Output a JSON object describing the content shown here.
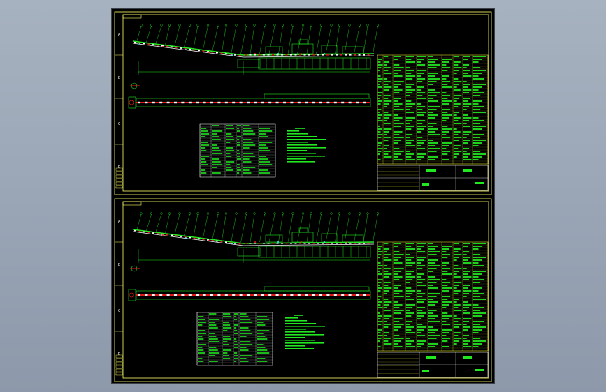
{
  "window": {
    "background": "#9aa6b6",
    "canvas_bg": "#000000"
  },
  "colors": {
    "frame": "#ffff66",
    "line_green": "#22e822",
    "line_red": "#e01818",
    "line_white": "#ffffff",
    "line_cyan": "#3df0ff",
    "table_line": "#ffff33"
  },
  "sheets": [
    {
      "id": "top",
      "zone_labels": [
        "A",
        "B",
        "C",
        "D"
      ]
    },
    {
      "id": "bottom",
      "zone_labels": [
        "A",
        "B",
        "C",
        "D"
      ]
    }
  ]
}
